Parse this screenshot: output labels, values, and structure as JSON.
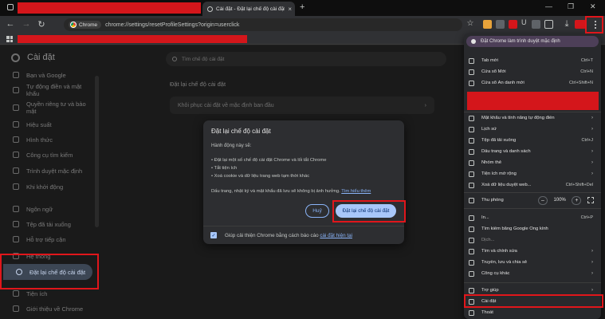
{
  "colors": {
    "annotation_red": "#e0161b",
    "accent_blue": "#8ab4f8",
    "primary_button": "#a8c7fa",
    "active_nav": "#3c4654"
  },
  "tabstrip": {
    "active_tab_title": "Cài đặt - Đặt lại chế độ cài đặt",
    "close_glyph": "×",
    "new_tab_glyph": "+",
    "minimize_glyph": "—",
    "maximize_glyph": "❐",
    "close_window_glyph": "✕"
  },
  "toolbar": {
    "back_glyph": "←",
    "forward_glyph": "→",
    "reload_glyph": "↻",
    "chip_label": "Chrome",
    "url": "chrome://settings/resetProfileSettings?origin=userclick",
    "star_glyph": "☆",
    "download_glyph": "⤓",
    "u_label": "U"
  },
  "sidebar": {
    "title": "Cài đặt",
    "items": [
      {
        "label": "Bạn và Google",
        "icon": "google-icon"
      },
      {
        "label": "Tự động điền và mật khẩu",
        "icon": "autofill-icon"
      },
      {
        "label": "Quyền riêng tư và bảo mật",
        "icon": "shield-icon"
      },
      {
        "label": "Hiệu suất",
        "icon": "speedometer-icon"
      },
      {
        "label": "Hình thức",
        "icon": "palette-icon"
      },
      {
        "label": "Công cụ tìm kiếm",
        "icon": "search-icon"
      },
      {
        "label": "Trình duyệt mặc định",
        "icon": "browser-icon"
      },
      {
        "label": "Khi khởi động",
        "icon": "power-icon"
      },
      {
        "label": "Ngôn ngữ",
        "icon": "translate-icon"
      },
      {
        "label": "Tệp đã tải xuống",
        "icon": "download-icon"
      },
      {
        "label": "Hỗ trợ tiếp cận",
        "icon": "accessibility-icon"
      },
      {
        "label": "Hệ thống",
        "icon": "wrench-icon"
      },
      {
        "label": "Đặt lại chế độ cài đặt",
        "icon": "reset-icon"
      },
      {
        "label": "Tiện ích",
        "icon": "puzzle-icon"
      },
      {
        "label": "Giới thiệu về Chrome",
        "icon": "chrome-icon"
      }
    ]
  },
  "main": {
    "search_placeholder": "Tìm chế độ cài đặt",
    "section_label": "Đặt lại chế độ cài đặt",
    "card_label": "Khôi phục cài đặt về mặc định ban đầu",
    "card_chevron": "›"
  },
  "dialog": {
    "title": "Đặt lại chế độ cài đặt",
    "intro": "Hành động này sẽ:",
    "bullets": [
      "• Đặt lại một số chế độ cài đặt Chrome và lối tắt Chrome",
      "• Tắt tiện ích",
      "• Xoá cookie và dữ liệu trang web tạm thời khác"
    ],
    "note": "Dấu trang, nhật ký và mật khẩu đã lưu sẽ không bị ảnh hưởng.",
    "learn_more": "Tìm hiểu thêm",
    "cancel_label": "Huỷ",
    "reset_label": "Đặt lại chế độ cài đặt",
    "footer_text": "Giúp cải thiện Chrome bằng cách báo cáo",
    "footer_link": "cài đặt hiện tại",
    "checkbox_checked": true,
    "check_glyph": "✓"
  },
  "menu": {
    "default_banner": "Đặt Chrome làm trình duyệt mặc định",
    "items": [
      {
        "label": "Tab mới",
        "shortcut": "Ctrl+T",
        "arrow": ""
      },
      {
        "label": "Cửa sổ Mới",
        "shortcut": "Ctrl+N",
        "arrow": ""
      },
      {
        "label": "Cửa sổ Ẩn danh mới",
        "shortcut": "Ctrl+Shift+N",
        "arrow": ""
      },
      {
        "label": "Mật khẩu và tính năng tự động điền",
        "shortcut": "",
        "arrow": "›"
      },
      {
        "label": "Lịch sử",
        "shortcut": "",
        "arrow": "›"
      },
      {
        "label": "Tệp đã tải xuống",
        "shortcut": "Ctrl+J",
        "arrow": ""
      },
      {
        "label": "Dấu trang và danh sách",
        "shortcut": "",
        "arrow": "›"
      },
      {
        "label": "Nhóm thẻ",
        "shortcut": "",
        "arrow": "›"
      },
      {
        "label": "Tiện ích mở rộng",
        "shortcut": "",
        "arrow": "›"
      },
      {
        "label": "Xoá dữ liệu duyệt web...",
        "shortcut": "Ctrl+Shift+Del",
        "arrow": ""
      },
      {
        "label": "Thu phóng",
        "shortcut": "",
        "arrow": ""
      },
      {
        "label": "In...",
        "shortcut": "Ctrl+P",
        "arrow": ""
      },
      {
        "label": "Tìm kiếm bằng Google Ống kính",
        "shortcut": "",
        "arrow": ""
      },
      {
        "label": "Dịch...",
        "shortcut": "",
        "arrow": ""
      },
      {
        "label": "Tìm và chỉnh sửa",
        "shortcut": "",
        "arrow": "›"
      },
      {
        "label": "Truyền, lưu và chia sẻ",
        "shortcut": "",
        "arrow": "›"
      },
      {
        "label": "Công cụ khác",
        "shortcut": "",
        "arrow": "›"
      },
      {
        "label": "Trợ giúp",
        "shortcut": "",
        "arrow": "›"
      },
      {
        "label": "Cài đặt",
        "shortcut": "",
        "arrow": ""
      },
      {
        "label": "Thoát",
        "shortcut": "",
        "arrow": ""
      }
    ],
    "zoom_minus": "–",
    "zoom_value": "100%",
    "zoom_plus": "+"
  }
}
